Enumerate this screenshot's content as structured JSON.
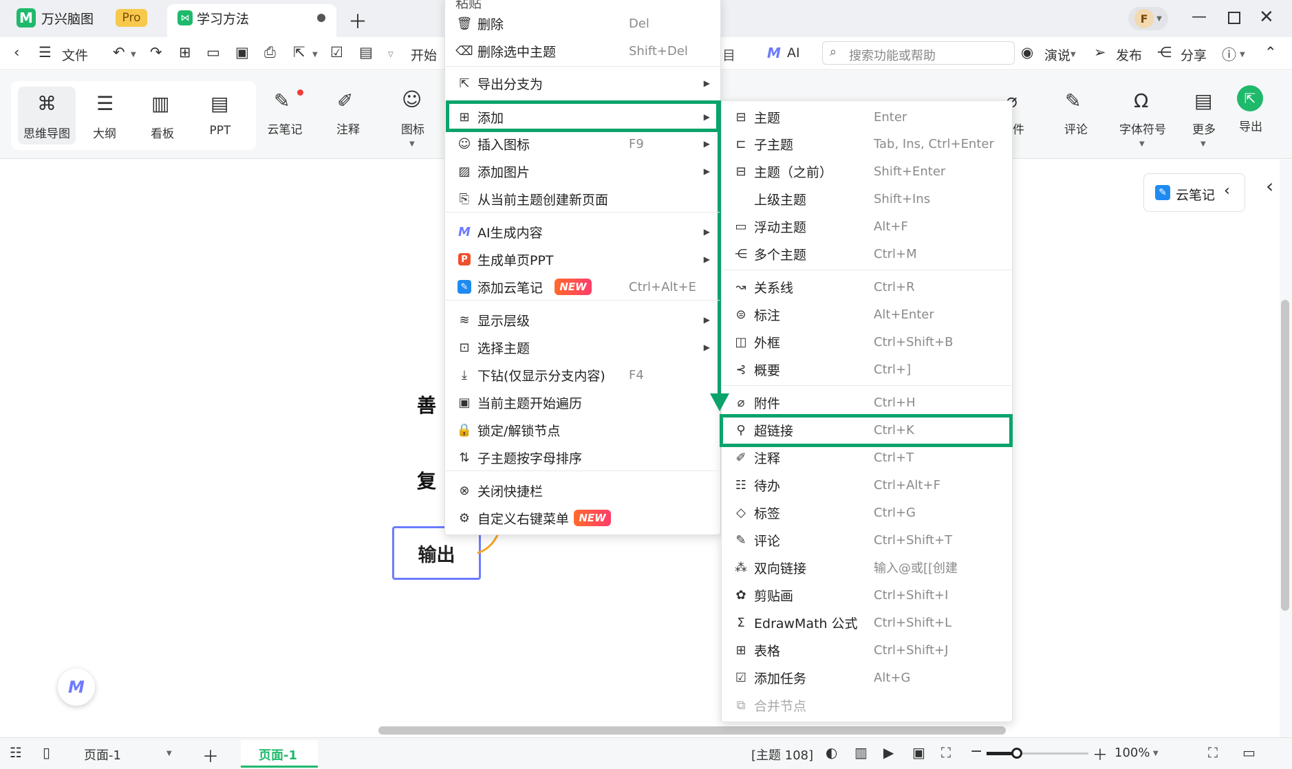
{
  "titlebar": {
    "app_name": "万兴脑图",
    "pro_badge": "Pro",
    "doc_tab": "学习方法",
    "avatar_letter": "F"
  },
  "toolbar": {
    "file": "文件",
    "start": "开始",
    "ai": "AI",
    "search_placeholder": "搜索功能或帮助",
    "present": "演说",
    "publish": "发布",
    "share": "分享"
  },
  "ribbon": {
    "view_buttons": [
      "思维导图",
      "大纲",
      "看板",
      "PPT"
    ],
    "cloud_note": "云笔记",
    "annotation": "注释",
    "icon": "图标",
    "attachment_partial": "件",
    "comment": "评论",
    "font_symbol": "字体符号",
    "more": "更多",
    "export": "导出"
  },
  "canvas": {
    "node_partial_1": "善",
    "node_partial_2": "复",
    "output_node": "输出",
    "cloud_note_button": "云笔记"
  },
  "context_menu": {
    "top_cut": "粘贴",
    "items": [
      {
        "icon": "trash-icon",
        "label": "删除",
        "shortcut": "Del"
      },
      {
        "icon": "delete-selected-icon",
        "label": "删除选中主题",
        "shortcut": "Shift+Del"
      },
      {
        "icon": "export-branch-icon",
        "label": "导出分支为",
        "submenu": true
      },
      {
        "icon": "add-icon",
        "label": "添加",
        "submenu": true,
        "highlighted": true
      },
      {
        "icon": "smiley-icon",
        "label": "插入图标",
        "shortcut": "F9",
        "submenu": true
      },
      {
        "icon": "image-icon",
        "label": "添加图片",
        "submenu": true
      },
      {
        "icon": "new-page-icon",
        "label": "从当前主题创建新页面"
      },
      {
        "icon": "ai-logo-icon",
        "label": "AI生成内容",
        "submenu": true
      },
      {
        "icon": "ppt-icon",
        "label": "生成单页PPT",
        "submenu": true
      },
      {
        "icon": "cloud-note-icon",
        "label": "添加云笔记",
        "shortcut": "Ctrl+Alt+E",
        "badge": "NEW"
      },
      {
        "icon": "layers-icon",
        "label": "显示层级",
        "submenu": true
      },
      {
        "icon": "select-topic-icon",
        "label": "选择主题",
        "submenu": true
      },
      {
        "icon": "drill-down-icon",
        "label": "下钻(仅显示分支内容)",
        "shortcut": "F4"
      },
      {
        "icon": "traverse-icon",
        "label": "当前主题开始遍历"
      },
      {
        "icon": "lock-icon",
        "label": "锁定/解锁节点"
      },
      {
        "icon": "sort-icon",
        "label": "子主题按字母排序"
      },
      {
        "icon": "close-circle-icon",
        "label": "关闭快捷栏"
      },
      {
        "icon": "gear-icon",
        "label": "自定义右键菜单",
        "badge": "NEW"
      }
    ]
  },
  "submenu": {
    "items": [
      {
        "icon": "topic-icon",
        "label": "主题",
        "shortcut": "Enter"
      },
      {
        "icon": "subtopic-icon",
        "label": "子主题",
        "shortcut": "Tab, Ins, Ctrl+Enter"
      },
      {
        "icon": "topic-before-icon",
        "label": "主题（之前）",
        "shortcut": "Shift+Enter"
      },
      {
        "icon": "",
        "label": "上级主题",
        "shortcut": "Shift+Ins"
      },
      {
        "icon": "floating-topic-icon",
        "label": "浮动主题",
        "shortcut": "Alt+F"
      },
      {
        "icon": "multiple-topics-icon",
        "label": "多个主题",
        "shortcut": "Ctrl+M"
      },
      {
        "icon": "relationship-icon",
        "label": "关系线",
        "shortcut": "Ctrl+R"
      },
      {
        "icon": "callout-icon",
        "label": "标注",
        "shortcut": "Alt+Enter"
      },
      {
        "icon": "boundary-icon",
        "label": "外框",
        "shortcut": "Ctrl+Shift+B"
      },
      {
        "icon": "summary-icon",
        "label": "概要",
        "shortcut": "Ctrl+]"
      },
      {
        "icon": "paperclip-icon",
        "label": "附件",
        "shortcut": "Ctrl+H"
      },
      {
        "icon": "link-icon",
        "label": "超链接",
        "shortcut": "Ctrl+K",
        "highlighted": true
      },
      {
        "icon": "note-icon",
        "label": "注释",
        "shortcut": "Ctrl+T"
      },
      {
        "icon": "todo-icon",
        "label": "待办",
        "shortcut": "Ctrl+Alt+F"
      },
      {
        "icon": "tag-icon",
        "label": "标签",
        "shortcut": "Ctrl+G"
      },
      {
        "icon": "comment-icon",
        "label": "评论",
        "shortcut": "Ctrl+Shift+T"
      },
      {
        "icon": "bidirectional-link-icon",
        "label": "双向链接",
        "shortcut": "输入@或[[创建"
      },
      {
        "icon": "clipart-icon",
        "label": "剪贴画",
        "shortcut": "Ctrl+Shift+I"
      },
      {
        "icon": "sigma-icon",
        "label": "EdrawMath 公式",
        "shortcut": "Ctrl+Shift+L"
      },
      {
        "icon": "table-icon",
        "label": "表格",
        "shortcut": "Ctrl+Shift+J"
      },
      {
        "icon": "task-icon",
        "label": "添加任务",
        "shortcut": "Alt+G"
      },
      {
        "icon": "merge-icon",
        "label": "合并节点",
        "disabled": true
      }
    ]
  },
  "statusbar": {
    "page_select": "页面-1",
    "active_page_tab": "页面-1",
    "topic_count": "[主题 108]",
    "zoom": "100%",
    "zoom_level": 0.3
  },
  "colors": {
    "highlight_green": "#0aa36b",
    "brand_green": "#1fb96c",
    "node_border": "#6c7bff"
  }
}
